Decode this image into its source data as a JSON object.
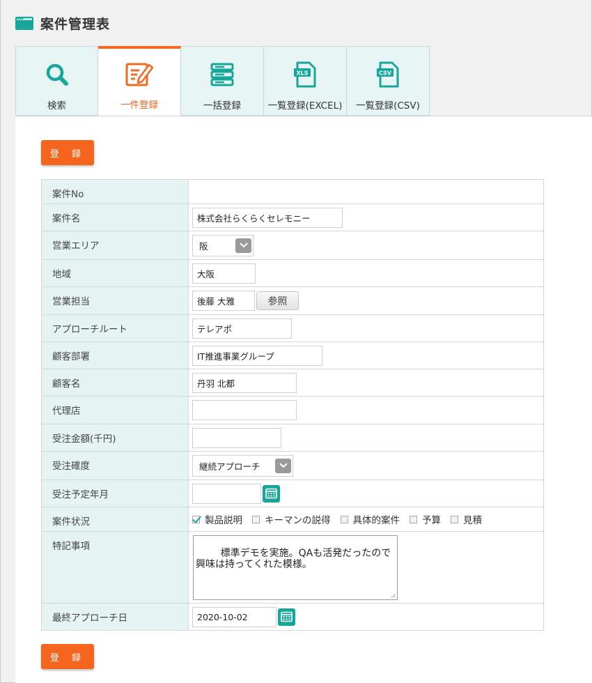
{
  "app": {
    "title": "案件管理表"
  },
  "tabs": [
    {
      "label": "検索",
      "icon": "search-icon",
      "active": false
    },
    {
      "label": "一件登録",
      "icon": "edit-icon",
      "active": true
    },
    {
      "label": "一括登録",
      "icon": "stack-icon",
      "active": false
    },
    {
      "label": "一覧登録(EXCEL)",
      "icon": "xls-file-icon",
      "file_badge": "XLS",
      "active": false
    },
    {
      "label": "一覧登録(CSV)",
      "icon": "csv-file-icon",
      "file_badge": "CSV",
      "active": false
    }
  ],
  "buttons": {
    "register_top": "登 録",
    "register_bottom": "登 録",
    "reference": "参照"
  },
  "form": {
    "case_no": {
      "label": "案件No",
      "value": ""
    },
    "case_name": {
      "label": "案件名",
      "value": "株式会社らくらくセレモニー"
    },
    "sales_area": {
      "label": "営業エリア",
      "value": "阪"
    },
    "region": {
      "label": "地域",
      "value": "大阪"
    },
    "sales_rep": {
      "label": "営業担当",
      "value": "後藤 大雅"
    },
    "approach_route": {
      "label": "アプローチルート",
      "value": "テレアポ"
    },
    "customer_dept": {
      "label": "顧客部署",
      "value": "IT推進事業グループ"
    },
    "customer_name": {
      "label": "顧客名",
      "value": "丹羽 北都"
    },
    "agency": {
      "label": "代理店",
      "value": ""
    },
    "order_amount": {
      "label": "受注金額(千円)",
      "value": ""
    },
    "order_certainty": {
      "label": "受注確度",
      "value": "継続アプローチ"
    },
    "order_month": {
      "label": "受注予定年月",
      "value": ""
    },
    "case_status": {
      "label": "案件状況",
      "options": [
        {
          "label": "製品説明",
          "checked": true
        },
        {
          "label": "キーマンの説得",
          "checked": false
        },
        {
          "label": "具体的案件",
          "checked": false
        },
        {
          "label": "予算",
          "checked": false
        },
        {
          "label": "見積",
          "checked": false
        }
      ]
    },
    "notes": {
      "label": "特記事項",
      "value": "標準デモを実施。QAも活発だったので\n興味は持ってくれた模様。"
    },
    "last_approach": {
      "label": "最終アプローチ日",
      "value": "2020-10-02"
    }
  },
  "colors": {
    "accent": "#f5651e",
    "teal": "#17a79a",
    "label_bg": "#e6f3f3",
    "tab_bg": "#e7f4f4"
  }
}
